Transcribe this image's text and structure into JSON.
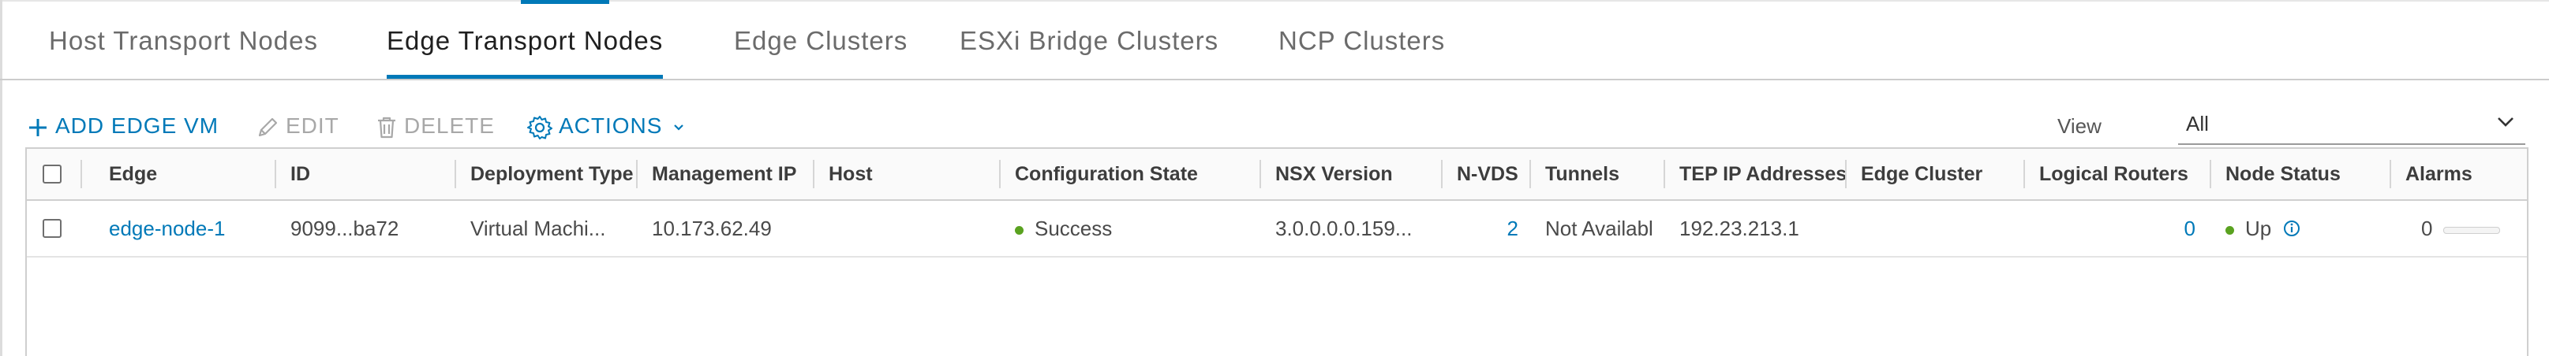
{
  "tabs": [
    {
      "label": "Host Transport Nodes",
      "active": false
    },
    {
      "label": "Edge Transport Nodes",
      "active": true
    },
    {
      "label": "Edge Clusters",
      "active": false
    },
    {
      "label": "ESXi Bridge Clusters",
      "active": false
    },
    {
      "label": "NCP Clusters",
      "active": false
    }
  ],
  "toolbar": {
    "add_edge_vm": "ADD EDGE VM",
    "edit": "EDIT",
    "delete": "DELETE",
    "actions": "ACTIONS"
  },
  "view": {
    "label": "View",
    "selected": "All"
  },
  "table": {
    "columns": [
      "Edge",
      "ID",
      "Deployment Type",
      "Management IP",
      "Host",
      "Configuration State",
      "NSX Version",
      "N-VDS",
      "Tunnels",
      "TEP IP Addresses",
      "Edge Cluster",
      "Logical Routers",
      "Node Status",
      "Alarms"
    ],
    "rows": [
      {
        "edge": "edge-node-1",
        "id": "9099...ba72",
        "deployment_type": "Virtual Machi...",
        "management_ip": "10.173.62.49",
        "host": "",
        "configuration_state": "Success",
        "nsx_version": "3.0.0.0.0.159...",
        "n_vds": "2",
        "tunnels": "Not Availabl",
        "tep_ip": "192.23.213.1",
        "edge_cluster": "",
        "logical_routers": "0",
        "node_status": "Up",
        "alarms": "0"
      }
    ]
  },
  "colors": {
    "accent": "#0079b8",
    "success": "#5aa220"
  }
}
